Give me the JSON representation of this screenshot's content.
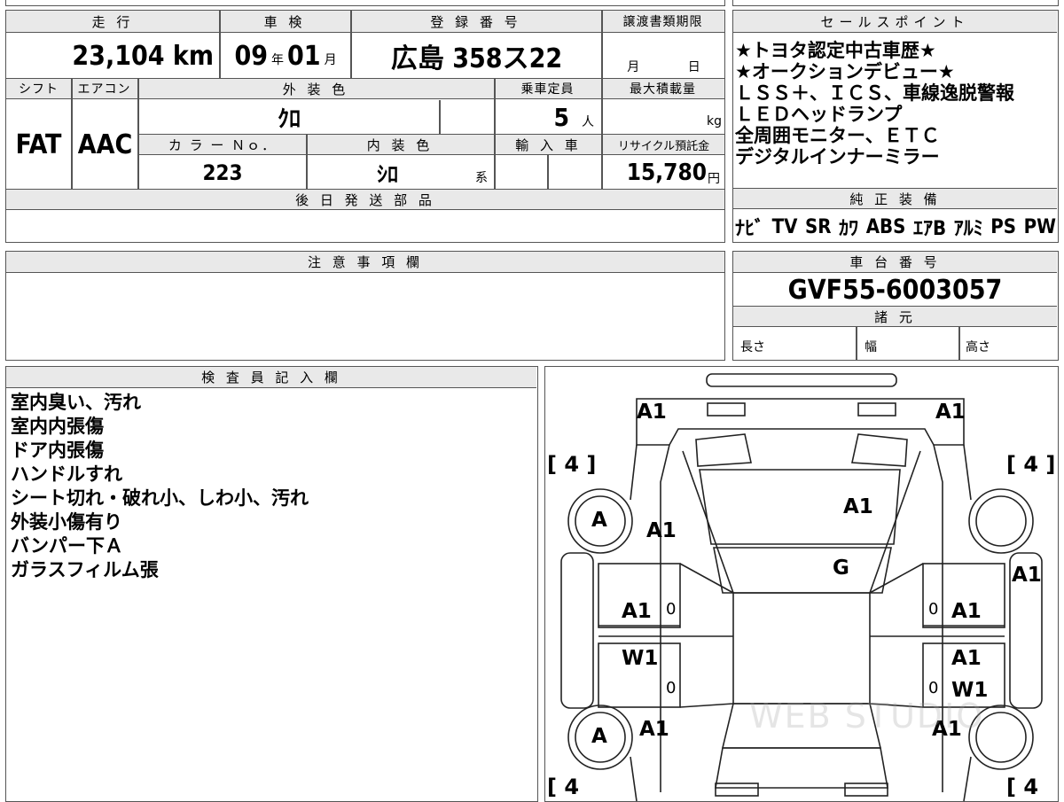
{
  "header": {
    "mileage_label": "走 行",
    "shaken_label": "車 検",
    "reg_label": "登 録 番 号",
    "transfer_label": "譲渡書類期限",
    "mileage": "23,104 km",
    "shaken_year": "09",
    "shaken_year_unit": "年",
    "shaken_month": "01",
    "shaken_month_unit": "月",
    "reg_number": "広島 358ス22",
    "transfer_month": "月",
    "transfer_day": "日"
  },
  "specs": {
    "shift_label": "シフト",
    "aircon_label": "エアコン",
    "ext_color_label": "外 装 色",
    "capacity_label": "乗車定員",
    "max_load_label": "最大積載量",
    "shift": "FAT",
    "aircon": "AAC",
    "ext_color": "ｸﾛ",
    "capacity": "5",
    "capacity_unit": "人",
    "max_load_unit": "kg",
    "color_no_label": "カ ラ ー Ｎｏ．",
    "int_color_label": "内 装 色",
    "import_label": "輸 入 車",
    "recycle_label": "リサイクル預託金",
    "color_no": "223",
    "int_color": "ｼﾛ",
    "int_color_suffix": "系",
    "recycle_fee": "15,780",
    "recycle_unit": "円",
    "later_parts_label": "後 日 発 送 部 品"
  },
  "sales_points": {
    "label": "セールスポイント",
    "lines": [
      "★トヨタ認定中古車歴★",
      "★オークションデビュー★",
      "ＬＳＳ＋、ＩＣＳ、車線逸脱警報",
      "ＬＥＤヘッドランプ",
      "全周囲モニター、ＥＴＣ",
      "デジタルインナーミラー"
    ]
  },
  "equipment": {
    "label": "純 正 装 備",
    "items": [
      "ﾅﾋﾞ",
      "TV",
      "SR",
      "ｶﾜ",
      "ABS",
      "ｴｱB",
      "ｱﾙﾐ",
      "PS",
      "PW"
    ]
  },
  "caution": {
    "label": "注 意 事 項 欄"
  },
  "chassis": {
    "label": "車 台 番 号",
    "number": "GVF55-6003057",
    "specs_label": "諸 元",
    "length_label": "長さ",
    "width_label": "幅",
    "height_label": "高さ"
  },
  "inspector": {
    "label": "検 査 員 記 入 欄",
    "notes": [
      "室内臭い、汚れ",
      "室内内張傷",
      "ドア内張傷",
      "ハンドルすれ",
      "シート切れ・破れ小、しわ小、汚れ",
      "外装小傷有り",
      "バンパー下Ａ",
      "ガラスフィルム張"
    ]
  },
  "diagram": {
    "tire_tl": "[ 4 ]",
    "tire_tr": "[ 4 ]",
    "tire_bl": "[ 4",
    "tire_br": "[ 4",
    "front_left": "A1",
    "front_right": "A1",
    "wheel_fl": "A",
    "wheel_rl": "A",
    "fender_fl": "A1",
    "hood": "A1",
    "windshield": "G",
    "fender_fr": "A1",
    "door_fl": "A1",
    "door_fr": "A1",
    "door_rl": "W1",
    "door_rr": "A1",
    "door_rr2": "W1",
    "rear_fl": "A1",
    "rear_fr": "A1",
    "mark_0": "0",
    "watermark": "WEB STUDIO"
  }
}
